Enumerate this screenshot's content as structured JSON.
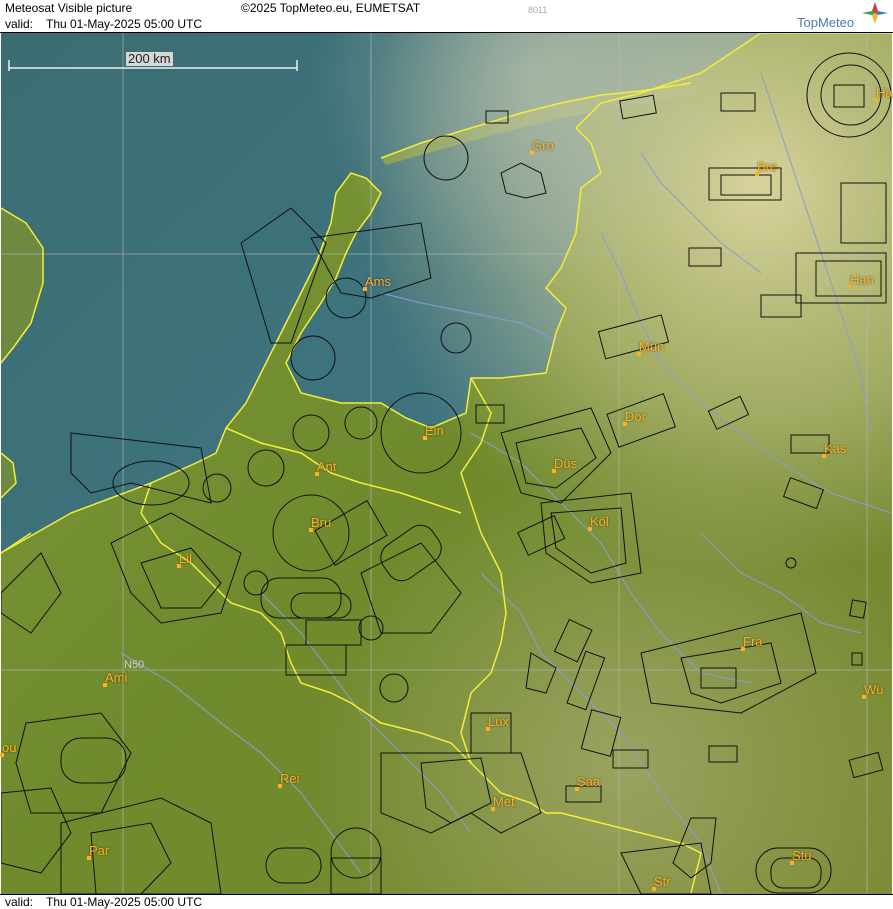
{
  "header": {
    "title": "Meteosat Visible picture",
    "copyright": "©2025 TopMeteo.eu, EUMETSAT",
    "code": "8011",
    "valid_label": "valid:",
    "valid_time": "Thu  01-May-2025  05:00 UTC",
    "brand": "TopMeteo"
  },
  "footer": {
    "valid_label": "valid:",
    "valid_time": "Thu  01-May-2025  05:00 UTC"
  },
  "map": {
    "scale_label": "200 km",
    "grid_label": "N50",
    "cities": [
      "Gro",
      "Ha",
      "Bre",
      "Ams",
      "Han",
      "Mün",
      "Ein",
      "Dor",
      "Kas",
      "Ant",
      "Düs",
      "Bru",
      "Köl",
      "Lil",
      "Fra",
      "Ami",
      "Wü",
      "Lux",
      "ou",
      "Rei",
      "Saa",
      "Met",
      "Par",
      "Stu",
      "Str"
    ],
    "colors": {
      "coast": "#f4ee3a",
      "labels": "#ffb01e",
      "rivers": "#8a9cd8",
      "airspace": "#111111",
      "sea": "#3a6f78",
      "land": "#6f8a2c"
    }
  }
}
